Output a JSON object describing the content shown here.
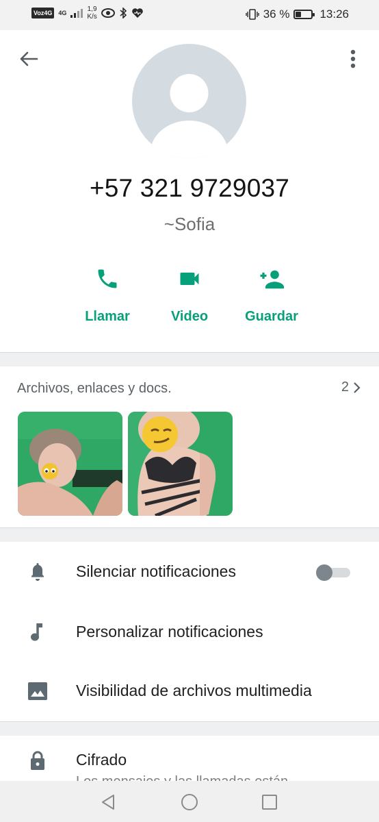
{
  "status_bar": {
    "carrier_badge": "Voz4G",
    "network": "4G",
    "speed_value": "1,9",
    "speed_unit": "K/s",
    "battery_percent": "36 %",
    "battery_level": 0.36,
    "time": "13:26"
  },
  "contact": {
    "phone": "+57 321 9729037",
    "push_name": "~Sofia"
  },
  "actions": [
    {
      "label": "Llamar",
      "icon": "phone-icon"
    },
    {
      "label": "Video",
      "icon": "videocam-icon"
    },
    {
      "label": "Guardar",
      "icon": "person-add-icon"
    }
  ],
  "media": {
    "title": "Archivos, enlaces y docs.",
    "count": "2"
  },
  "settings": [
    {
      "label": "Silenciar notificaciones",
      "icon": "bell-icon",
      "toggle_on": false
    },
    {
      "label": "Personalizar notificaciones",
      "icon": "music-note-icon"
    },
    {
      "label": "Visibilidad de archivos multimedia",
      "icon": "image-icon"
    }
  ],
  "encryption": {
    "label": "Cifrado",
    "subtitle": "Los mensajes y las llamadas están"
  },
  "colors": {
    "accent": "#08a07a",
    "icon_gray": "#5d6a72"
  }
}
